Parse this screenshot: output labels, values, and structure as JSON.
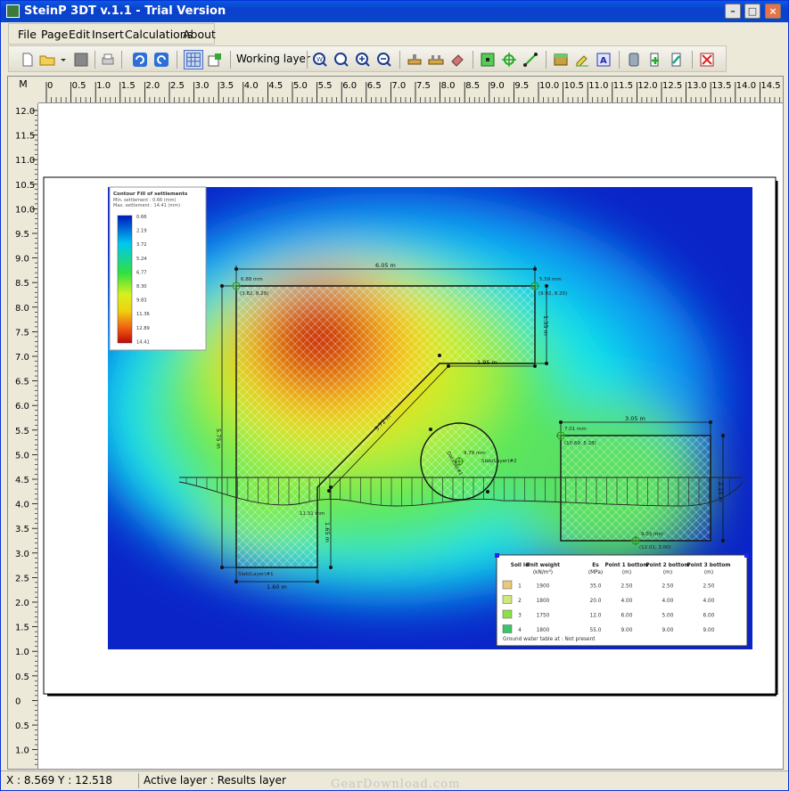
{
  "window": {
    "title": "SteinP 3DT v.1.1 - Trial Version"
  },
  "menu": {
    "items": [
      "File",
      "Page",
      "Edit",
      "Insert",
      "Calculations",
      "About"
    ]
  },
  "toolbar": {
    "working_layer_label": "Working layer"
  },
  "ruler": {
    "corner_label": "M",
    "h_ticks": [
      "0",
      "0.5",
      "1.0",
      "1.5",
      "2.0",
      "2.5",
      "3.0",
      "3.5",
      "4.0",
      "4.5",
      "5.0",
      "5.5",
      "6.0",
      "6.5",
      "7.0",
      "7.5",
      "8.0",
      "8.5",
      "9.0",
      "9.5",
      "10.0",
      "10.5",
      "11.0",
      "11.5",
      "12.0",
      "12.5",
      "13.0",
      "13.5",
      "14.0",
      "14.5"
    ],
    "v_ticks": [
      "12.0",
      "11.5",
      "11.0",
      "10.5",
      "10.0",
      "9.5",
      "9.0",
      "8.5",
      "8.0",
      "7.5",
      "7.0",
      "6.5",
      "6.0",
      "5.5",
      "5.0",
      "4.5",
      "4.0",
      "3.5",
      "3.0",
      "2.5",
      "2.0",
      "1.5",
      "1.0",
      "0.5",
      "0",
      "0.5",
      "1.0"
    ]
  },
  "legend": {
    "title": "Contour Fill of settlements",
    "min_line": "Min. settlement  : 0.66 (mm)",
    "max_line": "Max. settlement  : 14.41 (mm)",
    "values": [
      "0.66",
      "2.19",
      "3.72",
      "5.24",
      "6.77",
      "8.30",
      "9.83",
      "11.36",
      "12.89",
      "14.41"
    ]
  },
  "dimensions": {
    "top": "6.05 m",
    "left": "5.75 m",
    "diag": "3.72 m",
    "mid": "1.95 m",
    "rightv": "1.35 m",
    "bottom": "1.60 m",
    "bottomv": "1.65 m",
    "rect": "3.05 m",
    "rectv": "2.15 m"
  },
  "annotations": {
    "a1": "6.88 mm",
    "a2": "5.59 mm",
    "a3": "(3.82, 8.29)",
    "a4": "(9.92, 8.20)",
    "a5": "7.01 mm",
    "a6": "(10.69, 5.28)",
    "a7": "9.03 mm",
    "a8": "(12.01, 3.00)",
    "a9": "11.31 mm",
    "a10": "9.79 mm",
    "a11": "DataSet#1",
    "a12": "Slab(Layer)#1",
    "a13": "Slab(Layer)#2"
  },
  "soil_table": {
    "headers": [
      "Soil Id",
      "Unit weight (kN/m³)",
      "Es (MPa)",
      "Point 1 bottom (m)",
      "Point 2 bottom (m)",
      "Point 3 bottom (m)"
    ],
    "rows": [
      {
        "color": "#e8c87a",
        "id": "1",
        "uw": "1900",
        "es": "35.0",
        "p1": "2.50",
        "p2": "2.50",
        "p3": "2.50"
      },
      {
        "color": "#cfe87a",
        "id": "2",
        "uw": "1800",
        "es": "20.0",
        "p1": "4.00",
        "p2": "4.00",
        "p3": "4.00"
      },
      {
        "color": "#8ee04a",
        "id": "3",
        "uw": "1750",
        "es": "12.0",
        "p1": "6.00",
        "p2": "5.00",
        "p3": "6.00"
      },
      {
        "color": "#3cc46a",
        "id": "4",
        "uw": "1800",
        "es": "55.0",
        "p1": "9.00",
        "p2": "9.00",
        "p3": "9.00"
      }
    ],
    "footer": "Ground water table at : Not present"
  },
  "status": {
    "coords": "X : 8.569  Y : 12.518",
    "active_layer": "Active layer : Results layer"
  },
  "watermark": "GearDownload.com"
}
